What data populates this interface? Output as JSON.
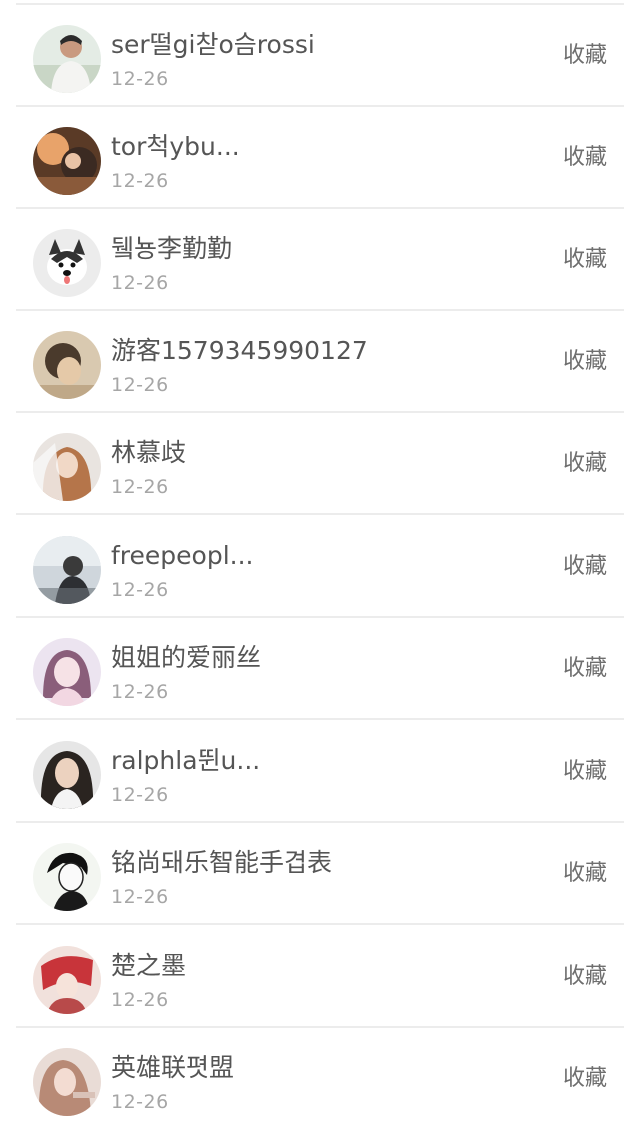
{
  "items": [
    {
      "name": "ser떨gi찯o슴rossi",
      "date": "12-26",
      "action": "收藏",
      "avatar": "avatar-photo"
    },
    {
      "name": "tor척ybu...",
      "date": "12-26",
      "action": "收藏",
      "avatar": "avatar-photo"
    },
    {
      "name": "뒠뇽李勤勤",
      "date": "12-26",
      "action": "收藏",
      "avatar": "avatar-photo"
    },
    {
      "name": "游客1579345990127",
      "date": "12-26",
      "action": "收藏",
      "avatar": "avatar-photo"
    },
    {
      "name": "林慕歧",
      "date": "12-26",
      "action": "收藏",
      "avatar": "avatar-photo"
    },
    {
      "name": "freepeopl...",
      "date": "12-26",
      "action": "收藏",
      "avatar": "avatar-photo"
    },
    {
      "name": "姐姐的爱丽丝",
      "date": "12-26",
      "action": "收藏",
      "avatar": "avatar-photo"
    },
    {
      "name": "ralphla뛴u...",
      "date": "12-26",
      "action": "收藏",
      "avatar": "avatar-photo"
    },
    {
      "name": "铭尚돼乐智能手겹表",
      "date": "12-26",
      "action": "收藏",
      "avatar": "avatar-photo"
    },
    {
      "name": "楚之墨",
      "date": "12-26",
      "action": "收藏",
      "avatar": "avatar-photo"
    },
    {
      "name": "英雄联폇盟",
      "date": "12-26",
      "action": "收藏",
      "avatar": "avatar-photo"
    }
  ]
}
